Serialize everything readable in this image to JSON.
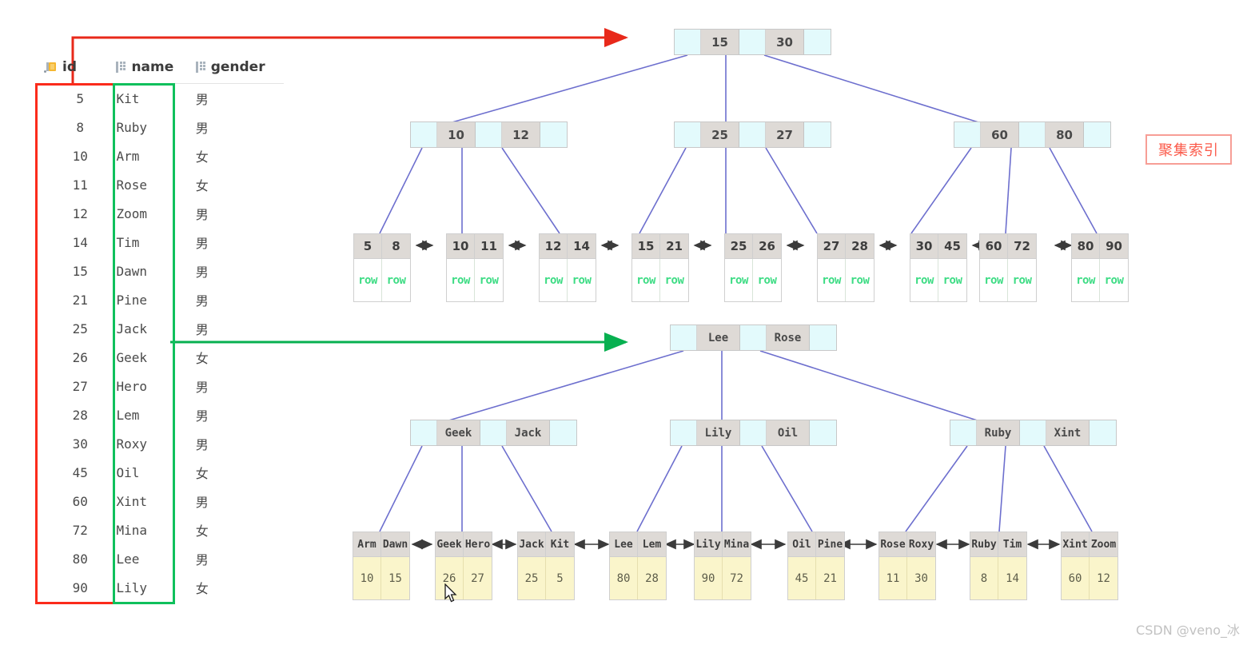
{
  "table": {
    "columns": [
      {
        "label": "id",
        "icon": "primary-key-icon"
      },
      {
        "label": "name",
        "icon": "column-grid-icon"
      },
      {
        "label": "gender",
        "icon": "column-grid-icon"
      }
    ],
    "rows": [
      {
        "id": "5",
        "name": "Kit",
        "gender": "男"
      },
      {
        "id": "8",
        "name": "Ruby",
        "gender": "男"
      },
      {
        "id": "10",
        "name": "Arm",
        "gender": "女"
      },
      {
        "id": "11",
        "name": "Rose",
        "gender": "女"
      },
      {
        "id": "12",
        "name": "Zoom",
        "gender": "男"
      },
      {
        "id": "14",
        "name": "Tim",
        "gender": "男"
      },
      {
        "id": "15",
        "name": "Dawn",
        "gender": "男"
      },
      {
        "id": "21",
        "name": "Pine",
        "gender": "男"
      },
      {
        "id": "25",
        "name": "Jack",
        "gender": "男"
      },
      {
        "id": "26",
        "name": "Geek",
        "gender": "女"
      },
      {
        "id": "27",
        "name": "Hero",
        "gender": "男"
      },
      {
        "id": "28",
        "name": "Lem",
        "gender": "男"
      },
      {
        "id": "30",
        "name": "Roxy",
        "gender": "男"
      },
      {
        "id": "45",
        "name": "Oil",
        "gender": "女"
      },
      {
        "id": "60",
        "name": "Xint",
        "gender": "男"
      },
      {
        "id": "72",
        "name": "Mina",
        "gender": "女"
      },
      {
        "id": "80",
        "name": "Lee",
        "gender": "男"
      },
      {
        "id": "90",
        "name": "Lily",
        "gender": "女"
      }
    ]
  },
  "annotations": {
    "cluster_label": "聚集索引",
    "watermark": "CSDN @veno_冰",
    "id_highlight_color": "#fb2b1b",
    "name_highlight_color": "#0fc05c",
    "id_arrow_color": "#e8291a",
    "name_arrow_color": "#07b050",
    "tree_link_color": "#6d6fce",
    "label_border_color": "#f79e96",
    "label_text_color": "#fb5a4a"
  },
  "primary_tree": {
    "name": "clustered-index-tree",
    "root": {
      "keys": [
        "15",
        "30"
      ]
    },
    "internal": [
      {
        "keys": [
          "10",
          "12"
        ]
      },
      {
        "keys": [
          "25",
          "27"
        ]
      },
      {
        "keys": [
          "60",
          "80"
        ]
      }
    ],
    "leaves": [
      {
        "keys": [
          "5",
          "8"
        ],
        "values": [
          "row",
          "row"
        ]
      },
      {
        "keys": [
          "10",
          "11"
        ],
        "values": [
          "row",
          "row"
        ]
      },
      {
        "keys": [
          "12",
          "14"
        ],
        "values": [
          "row",
          "row"
        ]
      },
      {
        "keys": [
          "15",
          "21"
        ],
        "values": [
          "row",
          "row"
        ]
      },
      {
        "keys": [
          "25",
          "26"
        ],
        "values": [
          "row",
          "row"
        ]
      },
      {
        "keys": [
          "27",
          "28"
        ],
        "values": [
          "row",
          "row"
        ]
      },
      {
        "keys": [
          "30",
          "45"
        ],
        "values": [
          "row",
          "row"
        ]
      },
      {
        "keys": [
          "60",
          "72"
        ],
        "values": [
          "row",
          "row"
        ]
      },
      {
        "keys": [
          "80",
          "90"
        ],
        "values": [
          "row",
          "row"
        ]
      }
    ]
  },
  "secondary_tree": {
    "name": "secondary-index-tree",
    "root": {
      "keys": [
        "Lee",
        "Rose"
      ]
    },
    "internal": [
      {
        "keys": [
          "Geek",
          "Jack"
        ]
      },
      {
        "keys": [
          "Lily",
          "Oil"
        ]
      },
      {
        "keys": [
          "Ruby",
          "Xint"
        ]
      }
    ],
    "leaves": [
      {
        "keys": [
          "Arm",
          "Dawn"
        ],
        "values": [
          "10",
          "15"
        ]
      },
      {
        "keys": [
          "Geek",
          "Hero"
        ],
        "values": [
          "26",
          "27"
        ]
      },
      {
        "keys": [
          "Jack",
          "Kit"
        ],
        "values": [
          "25",
          "5"
        ]
      },
      {
        "keys": [
          "Lee",
          "Lem"
        ],
        "values": [
          "80",
          "28"
        ]
      },
      {
        "keys": [
          "Lily",
          "Mina"
        ],
        "values": [
          "90",
          "72"
        ]
      },
      {
        "keys": [
          "Oil",
          "Pine"
        ],
        "values": [
          "45",
          "21"
        ]
      },
      {
        "keys": [
          "Rose",
          "Roxy"
        ],
        "values": [
          "11",
          "30"
        ]
      },
      {
        "keys": [
          "Ruby",
          "Tim"
        ],
        "values": [
          "8",
          "14"
        ]
      },
      {
        "keys": [
          "Xint",
          "Zoom"
        ],
        "values": [
          "60",
          "12"
        ]
      }
    ]
  }
}
